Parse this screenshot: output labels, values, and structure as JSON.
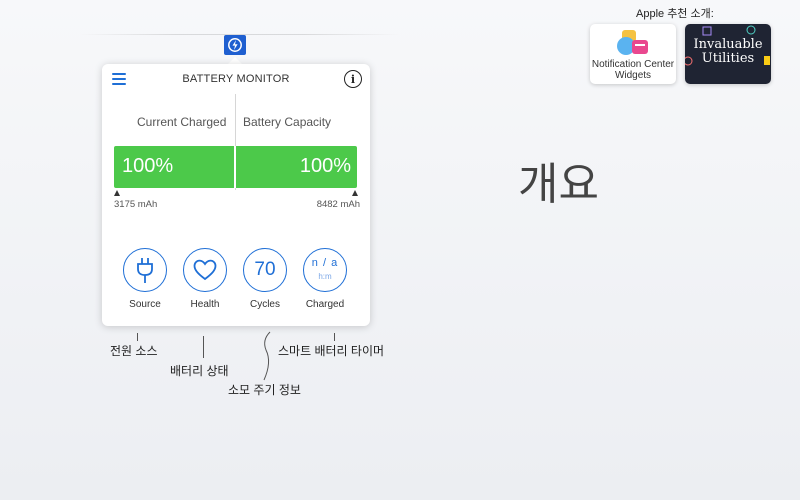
{
  "popover": {
    "title": "BATTERY MONITOR",
    "info_glyph": "i",
    "current_label": "Current Charged",
    "capacity_label": "Battery Capacity",
    "current_pct": "100%",
    "capacity_pct": "100%",
    "current_mah": "3175 mAh",
    "capacity_mah": "8482 mAh",
    "buttons": {
      "source": "Source",
      "health": "Health",
      "cycles": "Cycles",
      "cycles_value": "70",
      "charged": "Charged",
      "charged_value": "n / a",
      "charged_unit": "h:m"
    }
  },
  "callouts": {
    "power_source": "전원 소스",
    "battery_status": "배터리 상태",
    "cycle_info": "소모 주기 정보",
    "smart_timer": "스마트 배터리 타이머"
  },
  "main_title": "개요",
  "recommendations": {
    "title": "Apple 추천 소개:",
    "card1": "Notification Center Widgets",
    "card2": "Invaluable Utilities"
  },
  "colors": {
    "accent": "#1f6fd6",
    "battery_green": "#4cc94a",
    "status_icon_bg": "#1f5fd0"
  },
  "icons": {
    "status": "lightning-power-icon",
    "menu": "hamburger-menu-icon",
    "info": "info-icon",
    "source": "plug-icon",
    "health": "heart-icon"
  }
}
